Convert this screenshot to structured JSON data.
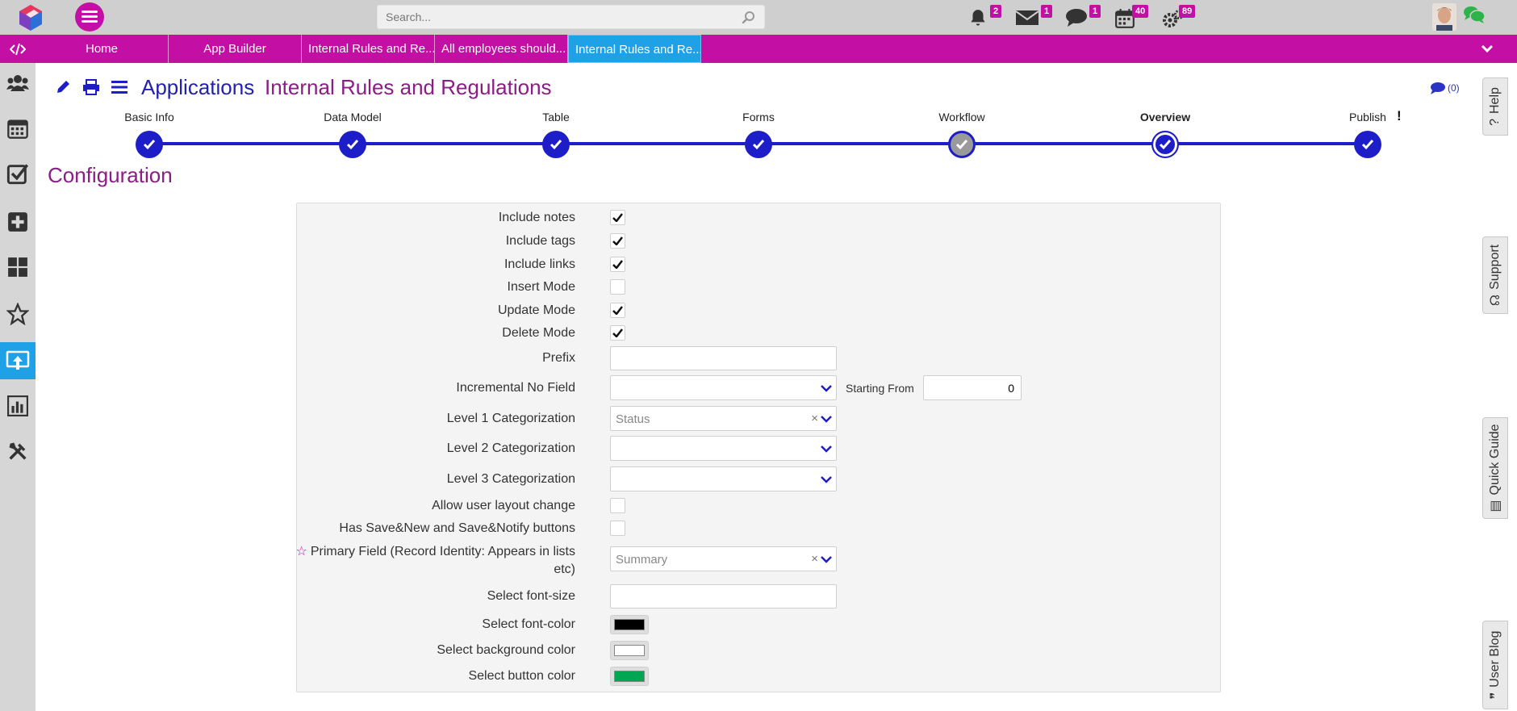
{
  "topbar": {
    "search_placeholder": "Search...",
    "notifications_count": "2",
    "mail_count": "1",
    "chat_count": "1",
    "calendar_count": "40",
    "tasks_count": "89"
  },
  "nav": {
    "tabs": [
      {
        "label": "Home"
      },
      {
        "label": "App Builder"
      },
      {
        "label": "Internal Rules and Re..."
      },
      {
        "label": "All employees should..."
      },
      {
        "label": "Internal Rules and Re..."
      }
    ]
  },
  "header": {
    "crumb_applications": "Applications",
    "crumb_app": "Internal Rules and Regulations",
    "comments_count": "(0)"
  },
  "stepper": {
    "steps": [
      {
        "label": "Basic Info"
      },
      {
        "label": "Data Model"
      },
      {
        "label": "Table"
      },
      {
        "label": "Forms"
      },
      {
        "label": "Workflow"
      },
      {
        "label": "Overview"
      },
      {
        "label": "Publish"
      }
    ],
    "publish_warning": "!"
  },
  "config": {
    "title": "Configuration",
    "include_notes": "Include notes",
    "include_tags": "Include tags",
    "include_links": "Include links",
    "insert_mode": "Insert Mode",
    "update_mode": "Update Mode",
    "delete_mode": "Delete Mode",
    "prefix": "Prefix",
    "prefix_value": "",
    "incremental_no_field": "Incremental No Field",
    "starting_from_label": "Starting From",
    "starting_from_value": "0",
    "level1": "Level 1 Categorization",
    "level1_value": "Status",
    "level2": "Level 2 Categorization",
    "level3": "Level 3 Categorization",
    "allow_layout_change": "Allow user layout change",
    "save_buttons": "Has Save&New and Save&Notify buttons",
    "primary_field_line1": "Primary Field (Record Identity: Appears in lists",
    "primary_field_line2": "etc)",
    "primary_field_value": "Summary",
    "font_size": "Select font-size",
    "font_color": "Select font-color",
    "background_color": "Select background color",
    "button_color": "Select button color",
    "font_color_value": "#000000",
    "background_color_value": "#ffffff",
    "button_color_value": "#00a651"
  },
  "right_tabs": {
    "help": "Help",
    "support": "Support",
    "quick_guide": "Quick Guide",
    "user_blog": "User Blog"
  },
  "colors": {
    "brand": "#c40fa4",
    "active_tab": "#1fa1e8",
    "stepper": "#1e1ec8",
    "title": "#8a1d86"
  }
}
